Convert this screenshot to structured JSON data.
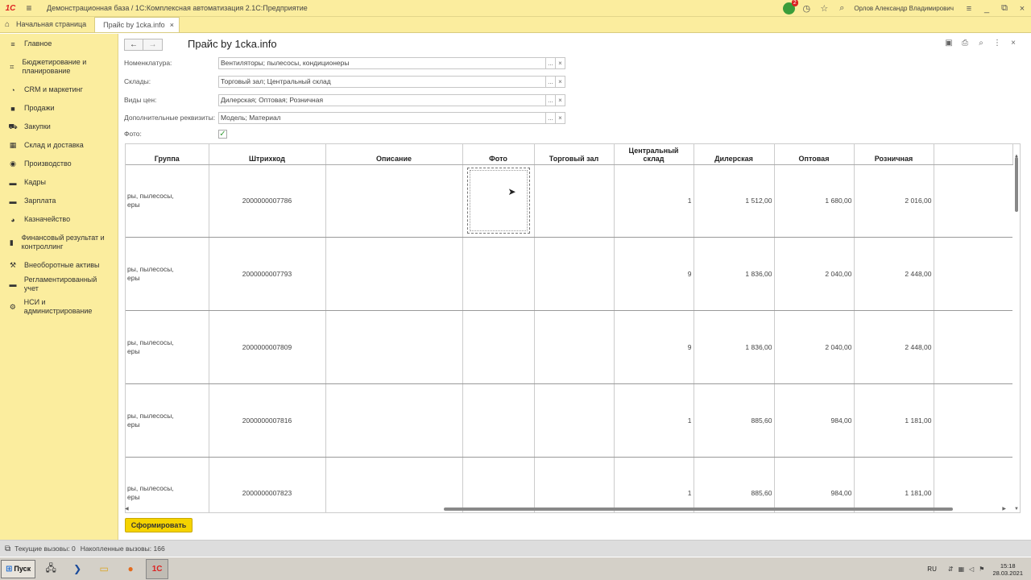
{
  "app": {
    "title": "Демонстрационная база / 1С:Комплексная автоматизация 2.1С:Предприятие",
    "user": "Орлов Александр Владимирович",
    "notification_count": "2"
  },
  "tabs": {
    "home": "Начальная страница",
    "active": "Прайс by 1cka.info"
  },
  "sidebar": {
    "items": [
      {
        "label": "Главное",
        "icon": "menu-icon"
      },
      {
        "label": "Бюджетирование и планирование",
        "icon": "budget-icon"
      },
      {
        "label": "CRM и маркетинг",
        "icon": "crm-icon"
      },
      {
        "label": "Продажи",
        "icon": "sales-icon"
      },
      {
        "label": "Закупки",
        "icon": "cart-icon"
      },
      {
        "label": "Склад и доставка",
        "icon": "warehouse-icon"
      },
      {
        "label": "Производство",
        "icon": "production-icon"
      },
      {
        "label": "Кадры",
        "icon": "hr-icon"
      },
      {
        "label": "Зарплата",
        "icon": "salary-icon"
      },
      {
        "label": "Казначейство",
        "icon": "treasury-icon"
      },
      {
        "label": "Финансовый результат и контроллинг",
        "icon": "chart-icon"
      },
      {
        "label": "Внеоборотные активы",
        "icon": "assets-icon"
      },
      {
        "label": "Регламентированный учет",
        "icon": "accounting-icon"
      },
      {
        "label": "НСИ и администрирование",
        "icon": "gear-icon"
      }
    ]
  },
  "page": {
    "title": "Прайс by 1cka.info"
  },
  "filters": {
    "nomenclature": {
      "label": "Номенклатура:",
      "value": "Вентиляторы; пылесосы, кондиционеры"
    },
    "warehouses": {
      "label": "Склады:",
      "value": "Торговый зал; Центральный склад"
    },
    "price_types": {
      "label": "Виды цен:",
      "value": "Дилерская; Оптовая; Розничная"
    },
    "extra": {
      "label": "Дополнительные реквизиты:",
      "value": "Модель; Материал"
    },
    "photo": {
      "label": "Фото:",
      "checked": true
    },
    "choose_btn": "...",
    "clear_btn": "×"
  },
  "table": {
    "headers": {
      "group": "Группа",
      "barcode": "Штрихкод",
      "description": "Описание",
      "photo": "Фото",
      "retail_hall": "Торговый зал",
      "central": "Центральный склад",
      "dealer": "Дилерская",
      "wholesale": "Оптовая",
      "retail": "Розничная"
    },
    "rows": [
      {
        "group": "ры, пылесосы, еры",
        "barcode": "2000000007786",
        "central": "1",
        "dealer": "1 512,00",
        "wholesale": "1 680,00",
        "retail": "2 016,00"
      },
      {
        "group": "ры, пылесосы, еры",
        "barcode": "2000000007793",
        "central": "9",
        "dealer": "1 836,00",
        "wholesale": "2 040,00",
        "retail": "2 448,00"
      },
      {
        "group": "ры, пылесосы, еры",
        "barcode": "2000000007809",
        "central": "9",
        "dealer": "1 836,00",
        "wholesale": "2 040,00",
        "retail": "2 448,00"
      },
      {
        "group": "ры, пылесосы, еры",
        "barcode": "2000000007816",
        "central": "1",
        "dealer": "885,60",
        "wholesale": "984,00",
        "retail": "1 181,00"
      },
      {
        "group": "ры, пылесосы, еры",
        "barcode": "2000000007823",
        "central": "1",
        "dealer": "885,60",
        "wholesale": "984,00",
        "retail": "1 181,00"
      }
    ]
  },
  "buttons": {
    "generate": "Сформировать"
  },
  "statusbar": {
    "current_calls": "Текущие вызовы: 0",
    "total_calls": "Накопленные вызовы: 166"
  },
  "taskbar": {
    "start": "Пуск",
    "lang": "RU",
    "time": "15:18",
    "date": "28.03.2021"
  },
  "colors": {
    "panel": "#fbed9e",
    "accent_button": "#f5d300",
    "check": "#3a9d3a"
  }
}
